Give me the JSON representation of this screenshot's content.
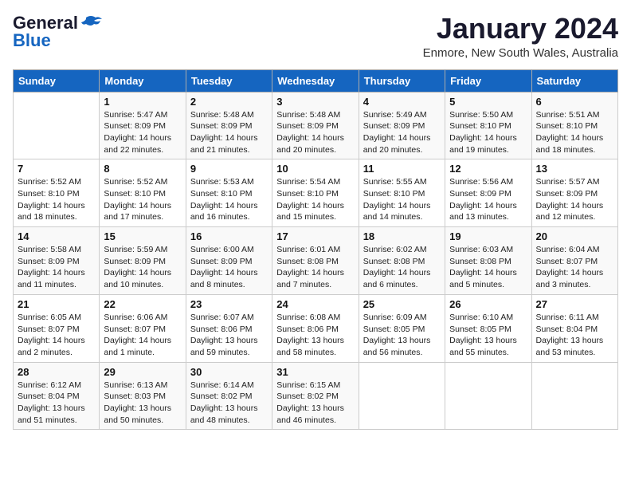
{
  "logo": {
    "line1": "General",
    "line2": "Blue"
  },
  "title": "January 2024",
  "subtitle": "Enmore, New South Wales, Australia",
  "weekdays": [
    "Sunday",
    "Monday",
    "Tuesday",
    "Wednesday",
    "Thursday",
    "Friday",
    "Saturday"
  ],
  "weeks": [
    [
      {
        "day": "",
        "empty": true
      },
      {
        "day": "1",
        "sunrise": "5:47 AM",
        "sunset": "8:09 PM",
        "daylight": "14 hours and 22 minutes."
      },
      {
        "day": "2",
        "sunrise": "5:48 AM",
        "sunset": "8:09 PM",
        "daylight": "14 hours and 21 minutes."
      },
      {
        "day": "3",
        "sunrise": "5:48 AM",
        "sunset": "8:09 PM",
        "daylight": "14 hours and 20 minutes."
      },
      {
        "day": "4",
        "sunrise": "5:49 AM",
        "sunset": "8:09 PM",
        "daylight": "14 hours and 20 minutes."
      },
      {
        "day": "5",
        "sunrise": "5:50 AM",
        "sunset": "8:10 PM",
        "daylight": "14 hours and 19 minutes."
      },
      {
        "day": "6",
        "sunrise": "5:51 AM",
        "sunset": "8:10 PM",
        "daylight": "14 hours and 18 minutes."
      }
    ],
    [
      {
        "day": "7",
        "sunrise": "5:52 AM",
        "sunset": "8:10 PM",
        "daylight": "14 hours and 18 minutes."
      },
      {
        "day": "8",
        "sunrise": "5:52 AM",
        "sunset": "8:10 PM",
        "daylight": "14 hours and 17 minutes."
      },
      {
        "day": "9",
        "sunrise": "5:53 AM",
        "sunset": "8:10 PM",
        "daylight": "14 hours and 16 minutes."
      },
      {
        "day": "10",
        "sunrise": "5:54 AM",
        "sunset": "8:10 PM",
        "daylight": "14 hours and 15 minutes."
      },
      {
        "day": "11",
        "sunrise": "5:55 AM",
        "sunset": "8:10 PM",
        "daylight": "14 hours and 14 minutes."
      },
      {
        "day": "12",
        "sunrise": "5:56 AM",
        "sunset": "8:09 PM",
        "daylight": "14 hours and 13 minutes."
      },
      {
        "day": "13",
        "sunrise": "5:57 AM",
        "sunset": "8:09 PM",
        "daylight": "14 hours and 12 minutes."
      }
    ],
    [
      {
        "day": "14",
        "sunrise": "5:58 AM",
        "sunset": "8:09 PM",
        "daylight": "14 hours and 11 minutes."
      },
      {
        "day": "15",
        "sunrise": "5:59 AM",
        "sunset": "8:09 PM",
        "daylight": "14 hours and 10 minutes."
      },
      {
        "day": "16",
        "sunrise": "6:00 AM",
        "sunset": "8:09 PM",
        "daylight": "14 hours and 8 minutes."
      },
      {
        "day": "17",
        "sunrise": "6:01 AM",
        "sunset": "8:08 PM",
        "daylight": "14 hours and 7 minutes."
      },
      {
        "day": "18",
        "sunrise": "6:02 AM",
        "sunset": "8:08 PM",
        "daylight": "14 hours and 6 minutes."
      },
      {
        "day": "19",
        "sunrise": "6:03 AM",
        "sunset": "8:08 PM",
        "daylight": "14 hours and 5 minutes."
      },
      {
        "day": "20",
        "sunrise": "6:04 AM",
        "sunset": "8:07 PM",
        "daylight": "14 hours and 3 minutes."
      }
    ],
    [
      {
        "day": "21",
        "sunrise": "6:05 AM",
        "sunset": "8:07 PM",
        "daylight": "14 hours and 2 minutes."
      },
      {
        "day": "22",
        "sunrise": "6:06 AM",
        "sunset": "8:07 PM",
        "daylight": "14 hours and 1 minute."
      },
      {
        "day": "23",
        "sunrise": "6:07 AM",
        "sunset": "8:06 PM",
        "daylight": "13 hours and 59 minutes."
      },
      {
        "day": "24",
        "sunrise": "6:08 AM",
        "sunset": "8:06 PM",
        "daylight": "13 hours and 58 minutes."
      },
      {
        "day": "25",
        "sunrise": "6:09 AM",
        "sunset": "8:05 PM",
        "daylight": "13 hours and 56 minutes."
      },
      {
        "day": "26",
        "sunrise": "6:10 AM",
        "sunset": "8:05 PM",
        "daylight": "13 hours and 55 minutes."
      },
      {
        "day": "27",
        "sunrise": "6:11 AM",
        "sunset": "8:04 PM",
        "daylight": "13 hours and 53 minutes."
      }
    ],
    [
      {
        "day": "28",
        "sunrise": "6:12 AM",
        "sunset": "8:04 PM",
        "daylight": "13 hours and 51 minutes."
      },
      {
        "day": "29",
        "sunrise": "6:13 AM",
        "sunset": "8:03 PM",
        "daylight": "13 hours and 50 minutes."
      },
      {
        "day": "30",
        "sunrise": "6:14 AM",
        "sunset": "8:02 PM",
        "daylight": "13 hours and 48 minutes."
      },
      {
        "day": "31",
        "sunrise": "6:15 AM",
        "sunset": "8:02 PM",
        "daylight": "13 hours and 46 minutes."
      },
      {
        "day": "",
        "empty": true
      },
      {
        "day": "",
        "empty": true
      },
      {
        "day": "",
        "empty": true
      }
    ]
  ],
  "labels": {
    "sunrise": "Sunrise:",
    "sunset": "Sunset:",
    "daylight": "Daylight:"
  }
}
